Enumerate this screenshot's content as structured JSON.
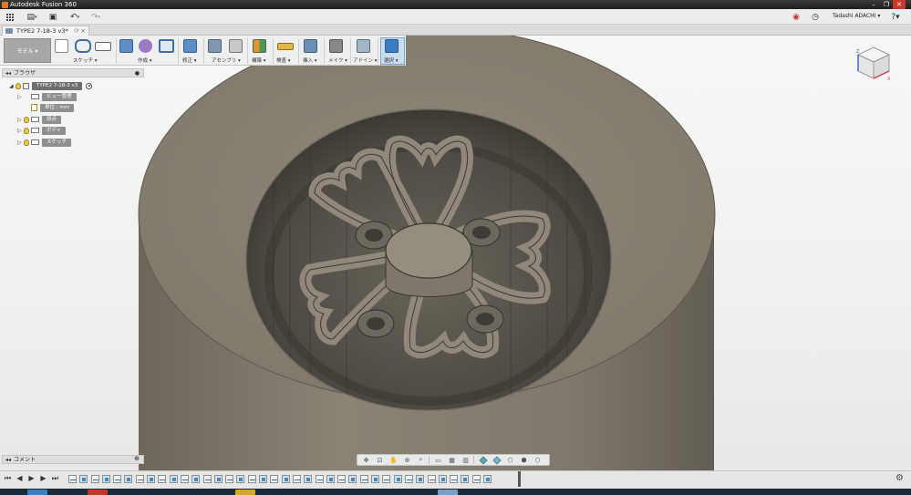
{
  "window": {
    "title": "Autodesk Fusion 360"
  },
  "quick_access": {
    "user_name": "Tadashi ADACHI ▾",
    "help": "?▾"
  },
  "document_tab": {
    "name": "TYPE2 7-18-3 v3*"
  },
  "ribbon": {
    "workspace": "モデル ▾",
    "groups": [
      {
        "label": "スケッチ ▾",
        "id": "sketch"
      },
      {
        "label": "作成 ▾",
        "id": "create"
      },
      {
        "label": "修正 ▾",
        "id": "modify"
      },
      {
        "label": "アセンブリ ▾",
        "id": "assemble"
      },
      {
        "label": "構築 ▾",
        "id": "construct"
      },
      {
        "label": "検査 ▾",
        "id": "inspect"
      },
      {
        "label": "挿入 ▾",
        "id": "insert"
      },
      {
        "label": "メイク ▾",
        "id": "make"
      },
      {
        "label": "アドイン ▾",
        "id": "addins"
      },
      {
        "label": "選択 ▾",
        "id": "select"
      }
    ]
  },
  "browser": {
    "header": "ブラウザ",
    "root": "TYPE2 7-18-3 v3",
    "nodes": [
      "ビュー管理",
      "単位 : mm",
      "原点",
      "ボディ",
      "スケッチ"
    ]
  },
  "comments": {
    "header": "コメント"
  },
  "colors": {
    "model_face": "#898275",
    "model_dark": "#5c574e",
    "selection_accent": "#3b7dbf"
  },
  "icons": [
    "grid-menu-icon",
    "file-icon",
    "save-icon",
    "undo-icon",
    "redo-icon",
    "record-icon",
    "clock-icon",
    "gear-icon",
    "view-cube"
  ]
}
